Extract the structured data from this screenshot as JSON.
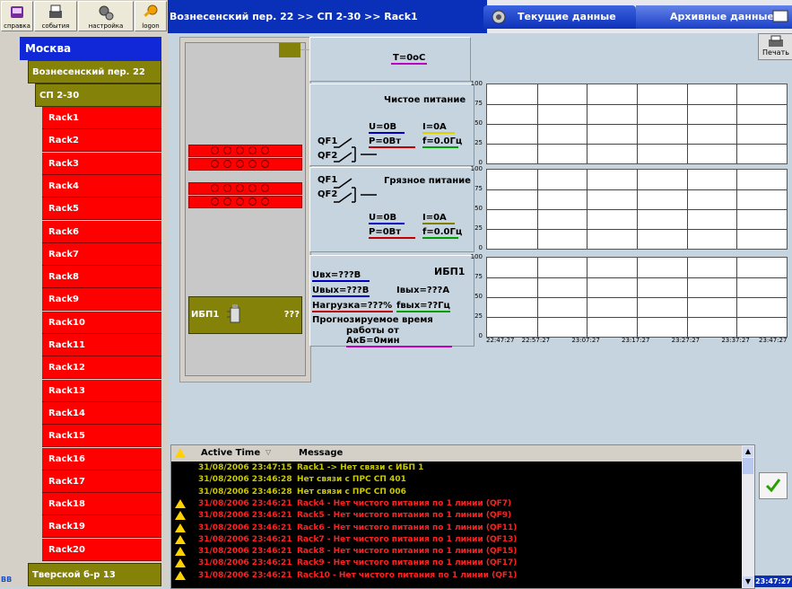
{
  "toolbar": [
    {
      "label": "справка",
      "icon": "help-book-icon"
    },
    {
      "label": "события",
      "icon": "printer-events-icon"
    },
    {
      "label": "настройка",
      "icon": "gears-icon"
    },
    {
      "label": "logon",
      "icon": "key-icon"
    }
  ],
  "header": {
    "path": "Вознесенский пер. 22 >> СП 2-30 >> Rack1",
    "tab_current": "Текущие данные",
    "tab_archive": "Архивные данные",
    "print_label": "Печать"
  },
  "tree": {
    "city": "Москва",
    "site": "Вознесенский пер. 22",
    "room": "СП 2-30",
    "racks": [
      "Rack1",
      "Rack2",
      "Rack3",
      "Rack4",
      "Rack5",
      "Rack6",
      "Rack7",
      "Rack8",
      "Rack9",
      "Rack10",
      "Rack11",
      "Rack12",
      "Rack13",
      "Rack14",
      "Rack15",
      "Rack16",
      "Rack17",
      "Rack18",
      "Rack19",
      "Rack20"
    ],
    "next_site": "Тверской б-р 13",
    "corner": "BB"
  },
  "rack": {
    "ups_label": "ИБП1",
    "ups_value": "???"
  },
  "temp": {
    "text": "T=0oC"
  },
  "clean": {
    "title": "Чистое питание",
    "u": "U=0B",
    "i": "I=0A",
    "p": "P=0Вт",
    "f": "f=0.0Гц",
    "qf1": "QF1",
    "qf2": "QF2"
  },
  "dirty": {
    "title": "Грязное питание",
    "u": "U=0B",
    "i": "I=0A",
    "p": "P=0Вт",
    "f": "f=0.0Гц",
    "qf1": "QF1",
    "qf2": "QF2"
  },
  "ups": {
    "title": "ИБП1",
    "uin": "Uвх=???В",
    "uout": "Uвых=???В",
    "iout": "Iвых=???А",
    "load": "Нагрузка=???%",
    "fout": "fвых=??Гц",
    "forecast1": "Прогнозируемое время",
    "forecast2": "работы от АкБ=0мин"
  },
  "chart_axis": {
    "y_ticks": [
      "100",
      "75",
      "50",
      "25",
      "0"
    ],
    "x_ticks": [
      "22:47:27",
      "22:57:27",
      "23:07:27",
      "23:17:27",
      "23:27:27",
      "23:37:27",
      "23:47:27"
    ]
  },
  "alarms": {
    "col_time": "Active Time",
    "col_msg": "Message",
    "rows": [
      {
        "time": "31/08/2006 23:47:15",
        "msg": "Rack1 -> Нет связи с ИБП 1",
        "color": "#c8c800",
        "warn": false
      },
      {
        "time": "31/08/2006 23:46:28",
        "msg": "Нет связи с ПРС СП 401",
        "color": "#c8c800",
        "warn": false
      },
      {
        "time": "31/08/2006 23:46:28",
        "msg": "Нет связи с ПРС СП 006",
        "color": "#c8c800",
        "warn": false
      },
      {
        "time": "31/08/2006 23:46:21",
        "msg": "Rack4 - Нет чистого питания по 1 линии (QF7)",
        "color": "#ff2020",
        "warn": true
      },
      {
        "time": "31/08/2006 23:46:21",
        "msg": "Rack5 - Нет чистого питания по 1 линии (QF9)",
        "color": "#ff2020",
        "warn": true
      },
      {
        "time": "31/08/2006 23:46:21",
        "msg": "Rack6 - Нет чистого питания по 1 линии (QF11)",
        "color": "#ff2020",
        "warn": true
      },
      {
        "time": "31/08/2006 23:46:21",
        "msg": "Rack7 - Нет чистого питания по 1 линии (QF13)",
        "color": "#ff2020",
        "warn": true
      },
      {
        "time": "31/08/2006 23:46:21",
        "msg": "Rack8 - Нет чистого питания по 1 линии (QF15)",
        "color": "#ff2020",
        "warn": true
      },
      {
        "time": "31/08/2006 23:46:21",
        "msg": "Rack9 - Нет чистого питания по 1 линии (QF17)",
        "color": "#ff2020",
        "warn": true
      },
      {
        "time": "31/08/2006 23:46:21",
        "msg": "Rack10 - Нет чистого питания по 1 линии (QF1)",
        "color": "#ff2020",
        "warn": true
      }
    ]
  },
  "clock": "23:47:27"
}
